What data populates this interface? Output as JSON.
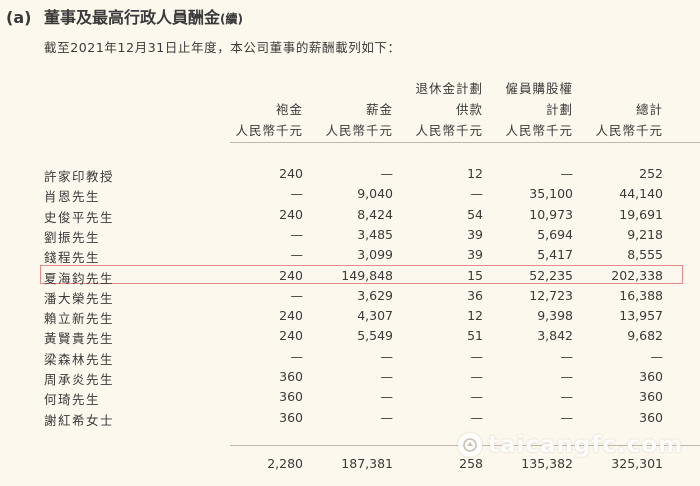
{
  "section": {
    "label": "(a)",
    "title": "董事及最高行政人員酬金",
    "continued": "(續)",
    "intro": "截至2021年12月31日止年度，本公司董事的薪酬載列如下："
  },
  "columns": [
    {
      "lines": [
        "",
        "袍金",
        "人民幣千元"
      ]
    },
    {
      "lines": [
        "",
        "薪金",
        "人民幣千元"
      ]
    },
    {
      "lines": [
        "退休金計劃",
        "供款",
        "人民幣千元"
      ]
    },
    {
      "lines": [
        "僱員購股權",
        "計劃",
        "人民幣千元"
      ]
    },
    {
      "lines": [
        "",
        "總計",
        "人民幣千元"
      ]
    }
  ],
  "rows": [
    {
      "name": "許家印教授",
      "values": [
        "240",
        "—",
        "12",
        "—",
        "252"
      ]
    },
    {
      "name": "肖恩先生",
      "values": [
        "—",
        "9,040",
        "—",
        "35,100",
        "44,140"
      ]
    },
    {
      "name": "史俊平先生",
      "values": [
        "240",
        "8,424",
        "54",
        "10,973",
        "19,691"
      ]
    },
    {
      "name": "劉振先生",
      "values": [
        "—",
        "3,485",
        "39",
        "5,694",
        "9,218"
      ]
    },
    {
      "name": "錢程先生",
      "values": [
        "—",
        "3,099",
        "39",
        "5,417",
        "8,555"
      ]
    },
    {
      "name": "夏海鈞先生",
      "values": [
        "240",
        "149,848",
        "15",
        "52,235",
        "202,338"
      ]
    },
    {
      "name": "潘大榮先生",
      "values": [
        "—",
        "3,629",
        "36",
        "12,723",
        "16,388"
      ]
    },
    {
      "name": "賴立新先生",
      "values": [
        "240",
        "4,307",
        "12",
        "9,398",
        "13,957"
      ]
    },
    {
      "name": "黃賢貴先生",
      "values": [
        "240",
        "5,549",
        "51",
        "3,842",
        "9,682"
      ]
    },
    {
      "name": "梁森林先生",
      "values": [
        "—",
        "—",
        "—",
        "—",
        "—"
      ]
    },
    {
      "name": "周承炎先生",
      "values": [
        "360",
        "—",
        "—",
        "—",
        "360"
      ]
    },
    {
      "name": "何琦先生",
      "values": [
        "360",
        "—",
        "—",
        "—",
        "360"
      ]
    },
    {
      "name": "謝紅希女士",
      "values": [
        "360",
        "—",
        "—",
        "—",
        "360"
      ]
    }
  ],
  "totals": [
    "2,280",
    "187,381",
    "258",
    "135,382",
    "325,301"
  ],
  "watermark": {
    "text": "taicangfc.com"
  },
  "colors": {
    "background": "#fdf8ed",
    "text": "#3a3a3a",
    "highlight_border": "#e38a8a",
    "rule": "#bdb8ae"
  }
}
